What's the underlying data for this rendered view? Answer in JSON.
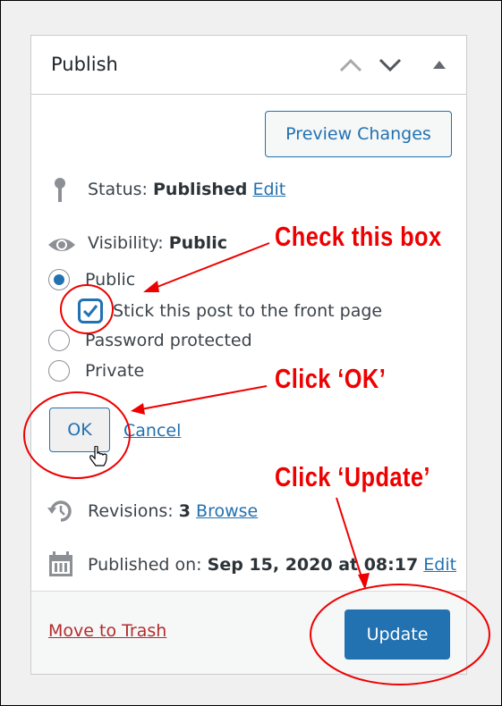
{
  "panel": {
    "title": "Publish",
    "header_icons": [
      "chevron-up-icon",
      "chevron-down-icon",
      "triangle-up-icon"
    ]
  },
  "preview_button": "Preview Changes",
  "status": {
    "label": "Status:",
    "value": "Published",
    "edit": "Edit"
  },
  "visibility": {
    "label": "Visibility:",
    "value": "Public",
    "options": [
      {
        "label": "Public",
        "selected": true
      },
      {
        "label": "Password protected",
        "selected": false
      },
      {
        "label": "Private",
        "selected": false
      }
    ],
    "sticky_label": "Stick this post to the front page",
    "sticky_checked": true,
    "ok": "OK",
    "cancel": "Cancel"
  },
  "revisions": {
    "label": "Revisions:",
    "count": "3",
    "browse": "Browse"
  },
  "published_on": {
    "label": "Published on:",
    "value": "Sep 15, 2020 at 08:17",
    "edit": "Edit"
  },
  "footer": {
    "trash": "Move to Trash",
    "update": "Update"
  },
  "annotations": {
    "check": "Check this box",
    "ok": "Click ‘OK’",
    "update": "Click ‘Update’",
    "color": "#ee0000"
  }
}
